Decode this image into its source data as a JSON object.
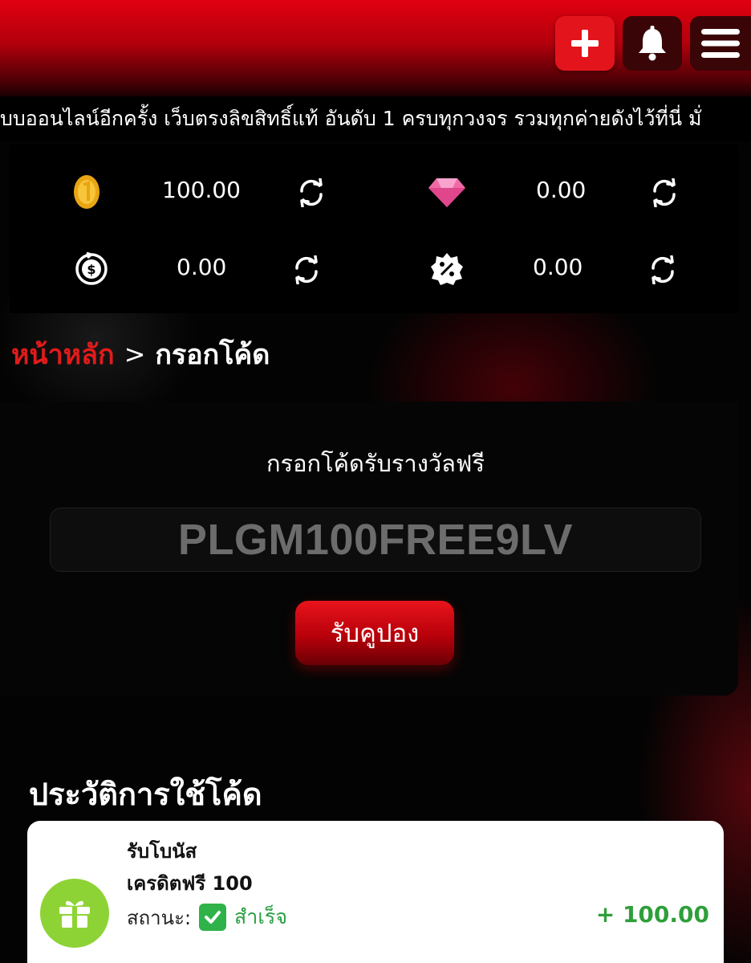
{
  "header": {
    "add_button_icon": "plus-icon",
    "notifications_icon": "bell-icon",
    "menu_icon": "hamburger-menu-icon"
  },
  "marquee": {
    "text": "บบออนไลน์อีกครั้ง เว็บตรงลิขสิทธิ์แท้ อันดับ 1 ครบทุกวงจร รวมทุกค่ายดังไว้ที่นี่ มั่"
  },
  "wallet": {
    "credit": "100.00",
    "diamond": "0.00",
    "cashback": "0.00",
    "discount": "0.00",
    "icons": [
      "coin-icon",
      "diamond-icon",
      "cashback-icon",
      "discount-badge-icon",
      "refresh-icon"
    ]
  },
  "breadcrumb": {
    "home": "หน้าหลัก",
    "separator": ">",
    "current": "กรอกโค้ด"
  },
  "redeem": {
    "title": "กรอกโค้ดรับรางวัลฟรี",
    "code_value": "PLGM100FREE9LV",
    "button_label": "รับคูปอง"
  },
  "history": {
    "title": "ประวัติการใช้โค้ด",
    "items": [
      {
        "type": "รับโบนัส",
        "name": "เครดิตฟรี 100",
        "status_label": "สถานะ:",
        "status_value": "สำเร็จ",
        "amount": "+ 100.00"
      }
    ]
  },
  "colors": {
    "accent_red": "#e00010",
    "breadcrumb_red": "#e11b1b",
    "success_green": "#2e9f3a",
    "gift_green": "#8ed335"
  }
}
